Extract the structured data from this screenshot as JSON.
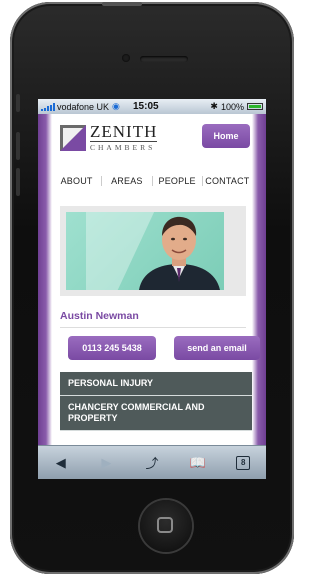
{
  "status_bar": {
    "carrier": "vodafone UK",
    "time": "15:05",
    "battery": "100%",
    "signal_bars": 5
  },
  "header": {
    "logo_name": "ZENITH",
    "logo_sub": "CHAMBERS",
    "home_label": "Home"
  },
  "nav": {
    "items": [
      "ABOUT",
      "AREAS",
      "PEOPLE",
      "CONTACT"
    ]
  },
  "profile": {
    "name": "Austin Newman",
    "phone_label": "0113 245 5438",
    "email_label": "send an email"
  },
  "practice_areas": [
    "PERSONAL INJURY",
    "CHANCERY COMMERCIAL AND PROPERTY"
  ],
  "toolbar": {
    "tab_count": "8"
  },
  "colors": {
    "brand_purple": "#7a4aa3",
    "list_bg": "#4f5a5a",
    "photo_bg": "#8fd8c5"
  }
}
